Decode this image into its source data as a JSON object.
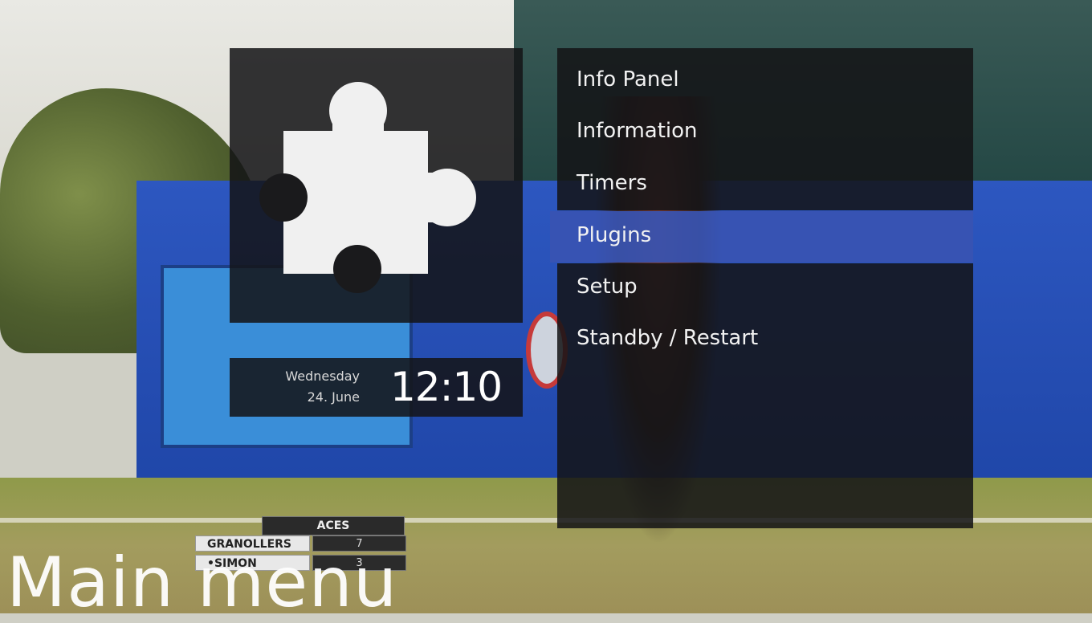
{
  "broadcast": {
    "aces_title": "ACES",
    "rows": [
      {
        "name": "GRANOLLERS",
        "value": "7"
      },
      {
        "name": "•SIMON",
        "value": "3"
      }
    ]
  },
  "icon": {
    "name": "puzzle-piece-icon",
    "color": "#f0f0f0"
  },
  "clock": {
    "weekday": "Wednesday",
    "date": "24. June",
    "time": "12:10"
  },
  "menu": {
    "items": [
      {
        "label": "Info Panel"
      },
      {
        "label": "Information"
      },
      {
        "label": "Timers"
      },
      {
        "label": "Plugins"
      },
      {
        "label": "Setup"
      },
      {
        "label": "Standby / Restart"
      }
    ],
    "selected_index": 3,
    "selected_color": "#3854b2"
  },
  "title": "Main menu"
}
